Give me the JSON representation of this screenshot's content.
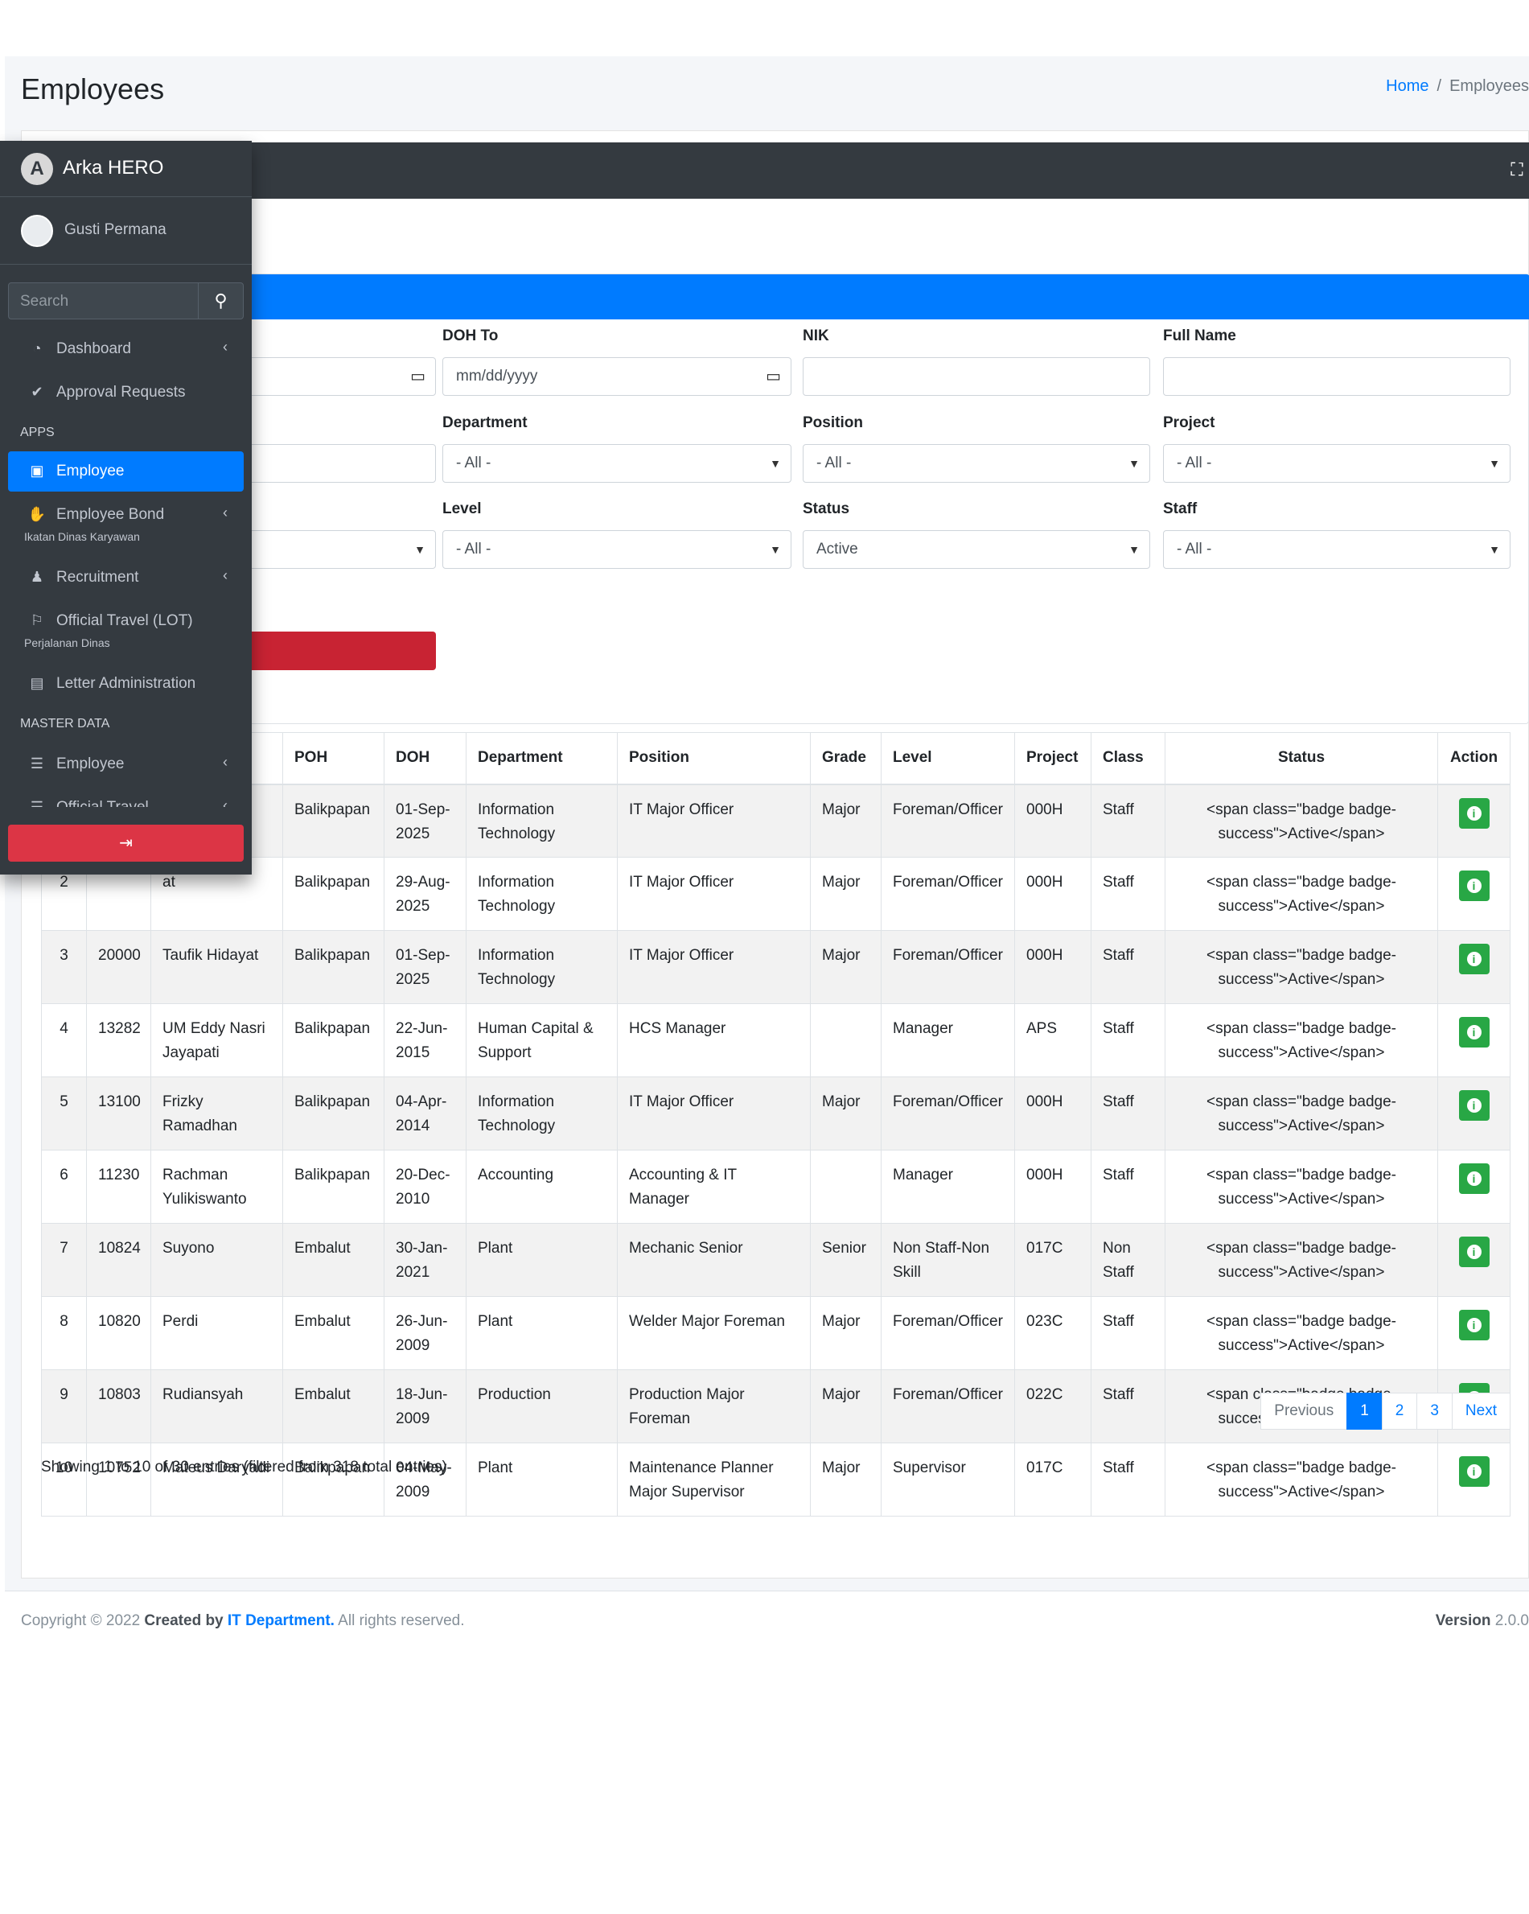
{
  "page": {
    "title": "Employees"
  },
  "breadcrumb": {
    "home": "Home",
    "current": "Employees"
  },
  "filters": {
    "doh_to": {
      "label": "DOH To",
      "placeholder": "mm/dd/yyyy"
    },
    "nik": {
      "label": "NIK",
      "value": ""
    },
    "full_name": {
      "label": "Full Name",
      "value": ""
    },
    "department": {
      "label": "Department",
      "value": "- All -"
    },
    "position": {
      "label": "Position",
      "value": "- All -"
    },
    "project": {
      "label": "Project",
      "value": "- All -"
    },
    "level": {
      "label": "Level",
      "value": "- All -"
    },
    "status": {
      "label": "Status",
      "value": "Active"
    },
    "staff": {
      "label": "Staff",
      "value": "- All -"
    },
    "partial_select_value": ""
  },
  "table": {
    "columns": [
      "POH",
      "DOH",
      "Department",
      "Position",
      "Grade",
      "Level",
      "Project",
      "Class",
      "Status",
      "Action"
    ],
    "rows": [
      {
        "no": "1",
        "nik": "",
        "name": "",
        "poh": "Balikpapan",
        "doh": "01-Sep-2025",
        "dept": "Information Technology",
        "position": "IT Major Officer",
        "grade": "Major",
        "level": "Foreman/Officer",
        "project": "000H",
        "class": "Staff",
        "status": "<span class=\"badge badge-success\">Active</span>"
      },
      {
        "no": "2",
        "nik": "",
        "name": "at",
        "poh": "Balikpapan",
        "doh": "29-Aug-2025",
        "dept": "Information Technology",
        "position": "IT Major Officer",
        "grade": "Major",
        "level": "Foreman/Officer",
        "project": "000H",
        "class": "Staff",
        "status": "<span class=\"badge badge-success\">Active</span>"
      },
      {
        "no": "3",
        "nik": "20000",
        "name": "Taufik Hidayat",
        "poh": "Balikpapan",
        "doh": "01-Sep-2025",
        "dept": "Information Technology",
        "position": "IT Major Officer",
        "grade": "Major",
        "level": "Foreman/Officer",
        "project": "000H",
        "class": "Staff",
        "status": "<span class=\"badge badge-success\">Active</span>"
      },
      {
        "no": "4",
        "nik": "13282",
        "name": "UM Eddy Nasri Jayapati",
        "poh": "Balikpapan",
        "doh": "22-Jun-2015",
        "dept": "Human Capital & Support",
        "position": "HCS Manager",
        "grade": "",
        "level": "Manager",
        "project": "APS",
        "class": "Staff",
        "status": "<span class=\"badge badge-success\">Active</span>"
      },
      {
        "no": "5",
        "nik": "13100",
        "name": "Frizky Ramadhan",
        "poh": "Balikpapan",
        "doh": "04-Apr-2014",
        "dept": "Information Technology",
        "position": "IT Major Officer",
        "grade": "Major",
        "level": "Foreman/Officer",
        "project": "000H",
        "class": "Staff",
        "status": "<span class=\"badge badge-success\">Active</span>"
      },
      {
        "no": "6",
        "nik": "11230",
        "name": "Rachman Yulikiswanto",
        "poh": "Balikpapan",
        "doh": "20-Dec-2010",
        "dept": "Accounting",
        "position": "Accounting & IT Manager",
        "grade": "",
        "level": "Manager",
        "project": "000H",
        "class": "Staff",
        "status": "<span class=\"badge badge-success\">Active</span>"
      },
      {
        "no": "7",
        "nik": "10824",
        "name": "Suyono",
        "poh": "Embalut",
        "doh": "30-Jan-2021",
        "dept": "Plant",
        "position": "Mechanic Senior",
        "grade": "Senior",
        "level": "Non Staff-Non Skill",
        "project": "017C",
        "class": "Non Staff",
        "status": "<span class=\"badge badge-success\">Active</span>"
      },
      {
        "no": "8",
        "nik": "10820",
        "name": "Perdi",
        "poh": "Embalut",
        "doh": "26-Jun-2009",
        "dept": "Plant",
        "position": "Welder Major Foreman",
        "grade": "Major",
        "level": "Foreman/Officer",
        "project": "023C",
        "class": "Staff",
        "status": "<span class=\"badge badge-success\">Active</span>"
      },
      {
        "no": "9",
        "nik": "10803",
        "name": "Rudiansyah",
        "poh": "Embalut",
        "doh": "18-Jun-2009",
        "dept": "Production",
        "position": "Production Major Foreman",
        "grade": "Major",
        "level": "Foreman/Officer",
        "project": "022C",
        "class": "Staff",
        "status": "<span class=\"badge badge-success\">Active</span>"
      },
      {
        "no": "10",
        "nik": "10752",
        "name": "Mateus Daryadi",
        "poh": "Balikpapan",
        "doh": "04-May-2009",
        "dept": "Plant",
        "position": "Maintenance Planner Major Supervisor",
        "grade": "Major",
        "level": "Supervisor",
        "project": "017C",
        "class": "Staff",
        "status": "<span class=\"badge badge-success\">Active</span>"
      }
    ]
  },
  "pagination": {
    "previous": "Previous",
    "pages": [
      "1",
      "2",
      "3"
    ],
    "active": "1",
    "next": "Next"
  },
  "info": "Showing 1 to 10 of 30 entries (filtered from 318 total entries)",
  "footer": {
    "copyright": "Copyright © 2022",
    "created_by": "Created by",
    "dept": "IT Department.",
    "rights": "All rights reserved.",
    "version_label": "Version",
    "version": "2.0.0"
  },
  "sidebar": {
    "brand_light": "Arka",
    "brand_bold": "HERO",
    "user": "Gusti Permana",
    "search_placeholder": "Search",
    "items": {
      "dashboard": "Dashboard",
      "approval": "Approval Requests",
      "apps_header": "APPS",
      "employee": "Employee",
      "employee_bond": "Employee Bond",
      "employee_bond_sub": "Ikatan Dinas Karyawan",
      "recruitment": "Recruitment",
      "official_travel": "Official Travel (LOT)",
      "official_travel_sub": "Perjalanan Dinas",
      "letter": "Letter Administration",
      "master_header": "MASTER DATA",
      "master_employee": "Employee",
      "master_official_travel": "Official Travel"
    }
  },
  "colors": {
    "primary": "#007bff",
    "danger": "#dc3545",
    "success": "#28a745",
    "sidebar": "#343a40"
  }
}
